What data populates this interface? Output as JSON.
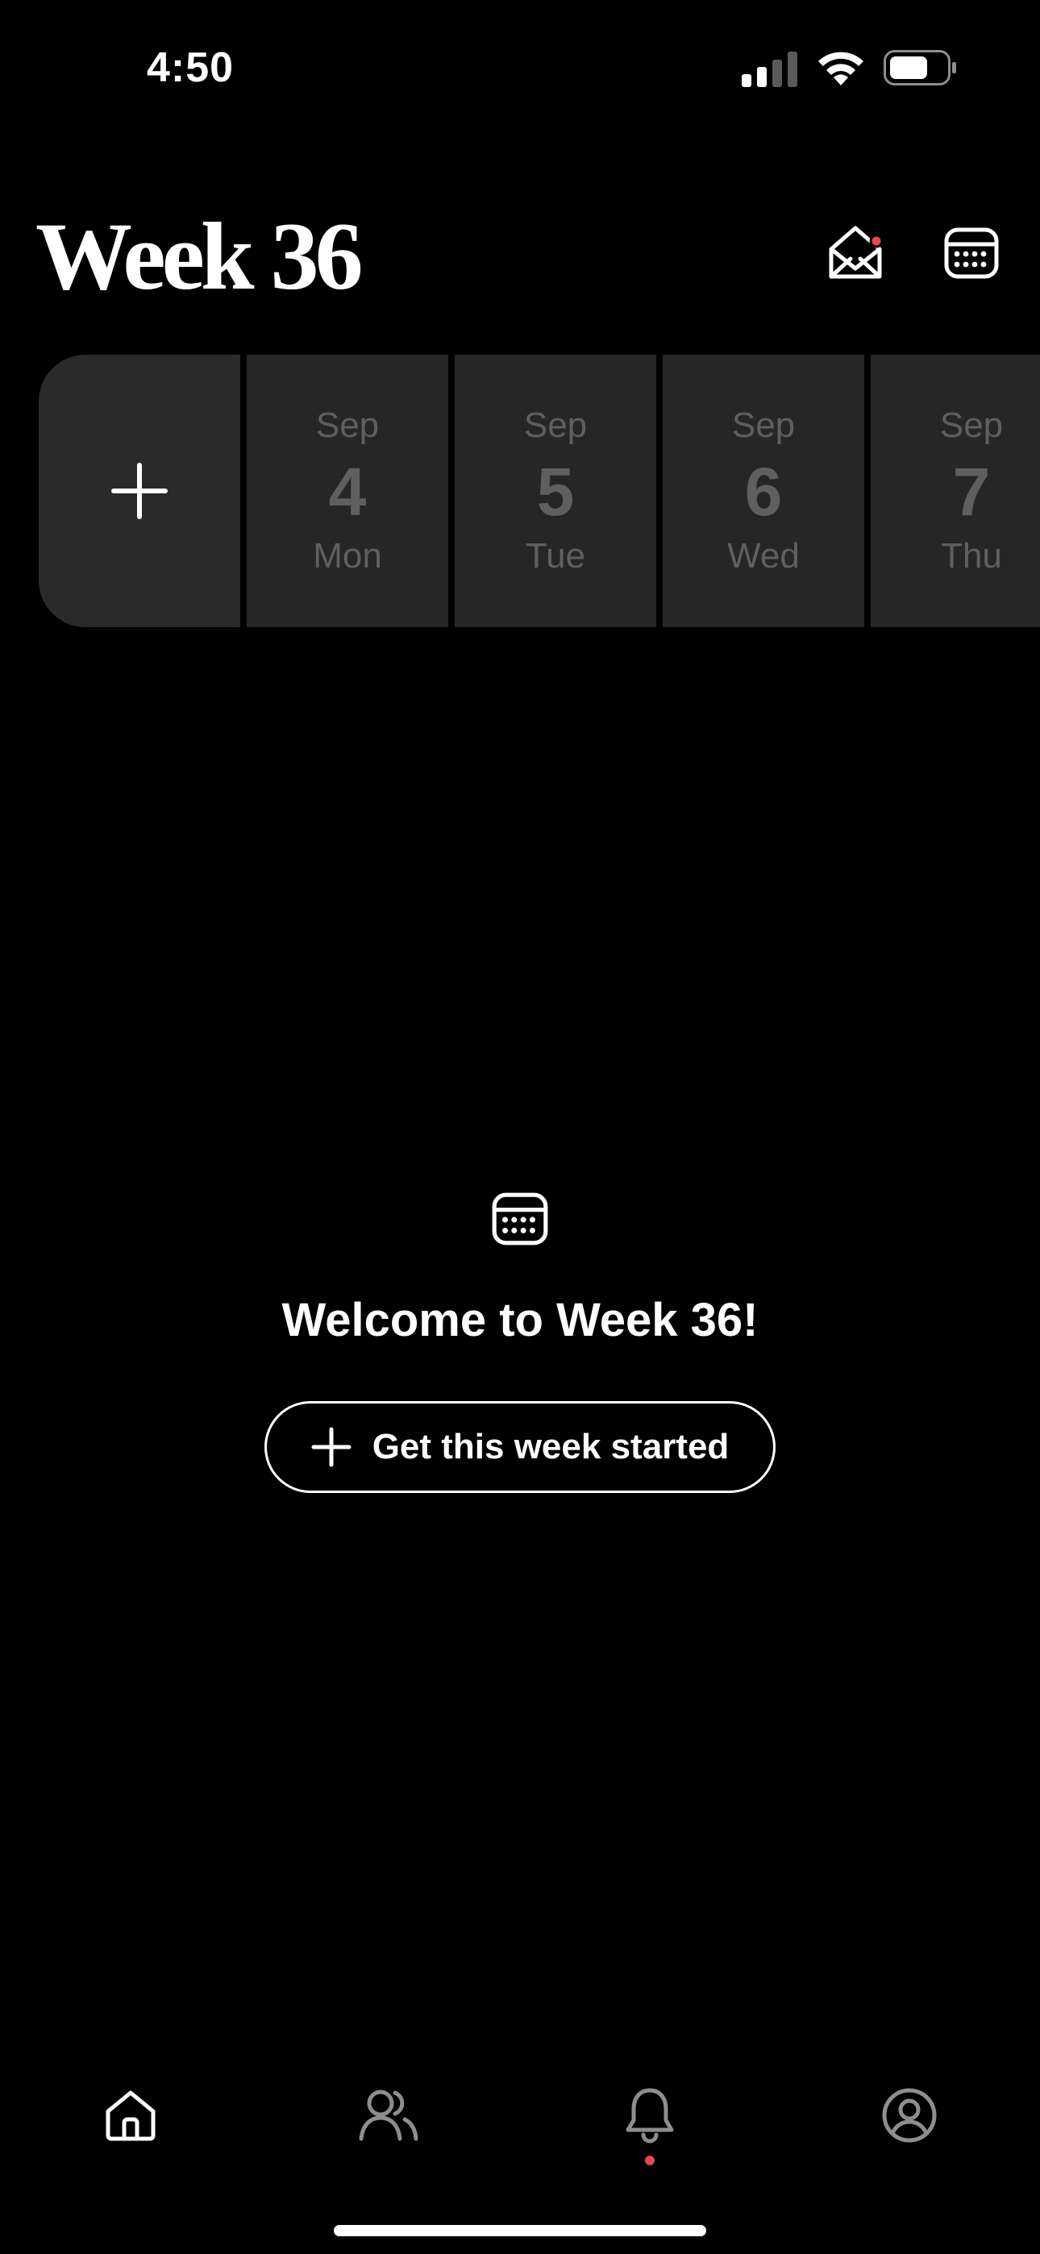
{
  "status_bar": {
    "time": "4:50",
    "icons": [
      "signal-icon",
      "wifi-icon",
      "battery-icon"
    ]
  },
  "header": {
    "title": "Week 36",
    "buttons": [
      "inbox-icon",
      "calendar-icon"
    ]
  },
  "day_strip": {
    "add_icon": "plus-icon",
    "days": [
      {
        "month": "Sep",
        "day": "4",
        "weekday": "Mon"
      },
      {
        "month": "Sep",
        "day": "5",
        "weekday": "Tue"
      },
      {
        "month": "Sep",
        "day": "6",
        "weekday": "Wed"
      },
      {
        "month": "Sep",
        "day": "7",
        "weekday": "Thu"
      }
    ]
  },
  "empty_state": {
    "icon": "calendar-icon",
    "message": "Welcome to Week 36!",
    "button_label": "Get this week started"
  },
  "tab_bar": {
    "tabs": [
      "home-icon",
      "friends-icon",
      "bell-icon",
      "profile-icon"
    ],
    "active": "home"
  },
  "colors": {
    "background": "#000000",
    "card": "#262626",
    "muted_text": "#5f5f5f",
    "notification_dot": "#e5484d",
    "inactive_icon": "#8e8e8e"
  }
}
